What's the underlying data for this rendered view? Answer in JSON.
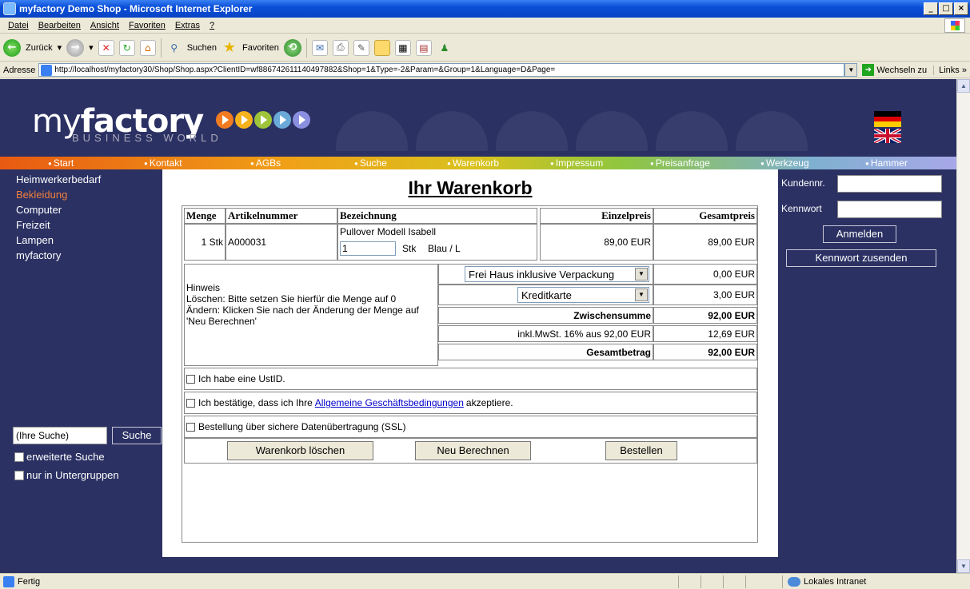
{
  "window": {
    "title": "myfactory Demo Shop - Microsoft Internet Explorer"
  },
  "menubar": [
    "Datei",
    "Bearbeiten",
    "Ansicht",
    "Favoriten",
    "Extras",
    "?"
  ],
  "toolbar": {
    "back": "Zurück",
    "search": "Suchen",
    "favorites": "Favoriten"
  },
  "address": {
    "label": "Adresse",
    "url": "http://localhost/myfactory30/Shop/Shop.aspx?ClientID=wf886742611140497882&Shop=1&Type=-2&Param=&Group=1&Language=D&Page=",
    "go": "Wechseln zu",
    "links": "Links"
  },
  "header": {
    "logo_light": "my",
    "logo_bold": "factory",
    "logo_sub": "BUSINESS WORLD"
  },
  "nav": [
    "Start",
    "Kontakt",
    "AGBs",
    "Suche",
    "Warenkorb",
    "Impressum",
    "Preisanfrage",
    "Werkzeug",
    "Hammer"
  ],
  "categories": [
    "Heimwerkerbedarf",
    "Bekleidung",
    "Computer",
    "Freizeit",
    "Lampen",
    "myfactory"
  ],
  "search": {
    "placeholder": "(Ihre Suche)",
    "button": "Suche",
    "extended": "erweiterte Suche",
    "subgroups": "nur in Untergruppen"
  },
  "login": {
    "customer_label": "Kundennr.",
    "password_label": "Kennwort",
    "login_button": "Anmelden",
    "send_password_button": "Kennwort zusenden"
  },
  "cart": {
    "title": "Ihr Warenkorb",
    "headers": {
      "qty": "Menge",
      "article_no": "Artikelnummer",
      "description": "Bezeichnung",
      "unit_price": "Einzelpreis",
      "total_price": "Gesamtpreis"
    },
    "item": {
      "qty": "1 Stk",
      "article_no": "A000031",
      "name": "Pullover Modell Isabell",
      "qty_input": "1",
      "unit": "Stk",
      "variant": "Blau / L",
      "unit_price": "89,00 EUR",
      "total_price": "89,00 EUR"
    },
    "note": {
      "title": "Hinweis",
      "delete": "Löschen: Bitte setzen Sie hierfür die Menge auf 0",
      "change": "Ändern: Klicken Sie nach der Änderung der Menge auf 'Neu Berechnen'"
    },
    "shipping": {
      "selected": "Frei Haus inklusive Verpackung",
      "amount": "0,00 EUR"
    },
    "payment": {
      "selected": "Kreditkarte",
      "amount": "3,00 EUR"
    },
    "subtotal": {
      "label": "Zwischensumme",
      "amount": "92,00 EUR"
    },
    "vat": {
      "label": "inkl.MwSt. 16% aus 92,00 EUR",
      "amount": "12,69 EUR"
    },
    "total": {
      "label": "Gesamtbetrag",
      "amount": "92,00 EUR"
    },
    "ustid": "Ich habe eine UstID.",
    "terms_pre": "Ich bestätige, dass ich Ihre",
    "terms_link": "Allgemeine Geschäftsbedingungen",
    "terms_post": "akzeptiere.",
    "ssl": "Bestellung über sichere Datenübertragung (SSL)",
    "buttons": {
      "clear": "Warenkorb löschen",
      "recalc": "Neu Berechnen",
      "order": "Bestellen"
    }
  },
  "status": {
    "text": "Fertig",
    "zone": "Lokales Intranet"
  },
  "colors": {
    "page_bg": "#2b3163",
    "active_category": "#f07f3c",
    "link": "#0000cc"
  }
}
